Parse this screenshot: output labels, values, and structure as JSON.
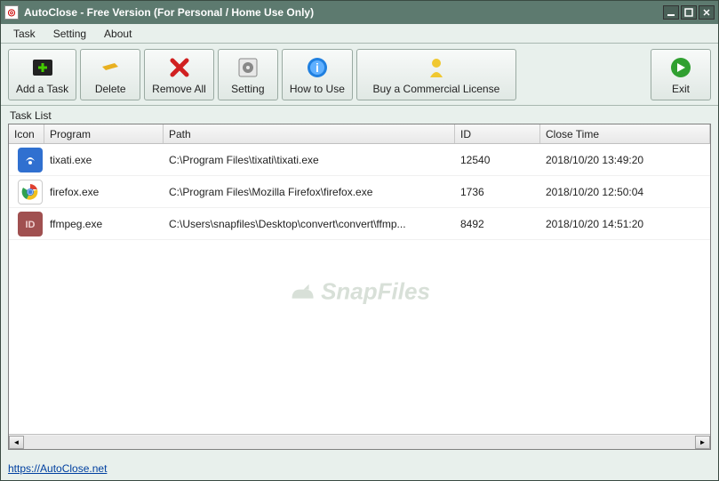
{
  "window": {
    "title": "AutoClose - Free Version (For Personal / Home Use Only)"
  },
  "menu": {
    "task": "Task",
    "setting": "Setting",
    "about": "About"
  },
  "toolbar": {
    "add": "Add a Task",
    "delete": "Delete",
    "remove_all": "Remove All",
    "setting": "Setting",
    "how_to": "How to Use",
    "buy": "Buy a Commercial License",
    "exit": "Exit"
  },
  "list": {
    "label": "Task List",
    "headers": {
      "icon": "Icon",
      "program": "Program",
      "path": "Path",
      "id": "ID",
      "close_time": "Close Time"
    },
    "rows": [
      {
        "program": "tixati.exe",
        "path": "C:\\Program Files\\tixati\\tixati.exe",
        "id": "12540",
        "close_time": "2018/10/20 13:49:20",
        "icon": "tixati-icon"
      },
      {
        "program": "firefox.exe",
        "path": "C:\\Program Files\\Mozilla Firefox\\firefox.exe",
        "id": "1736",
        "close_time": "2018/10/20 12:50:04",
        "icon": "chrome-icon"
      },
      {
        "program": "ffmpeg.exe",
        "path": "C:\\Users\\snapfiles\\Desktop\\convert\\convert\\ffmp...",
        "id": "8492",
        "close_time": "2018/10/20 14:51:20",
        "icon": "id-icon"
      }
    ]
  },
  "watermark": "SnapFiles",
  "footer": {
    "link": "https://AutoClose.net"
  }
}
